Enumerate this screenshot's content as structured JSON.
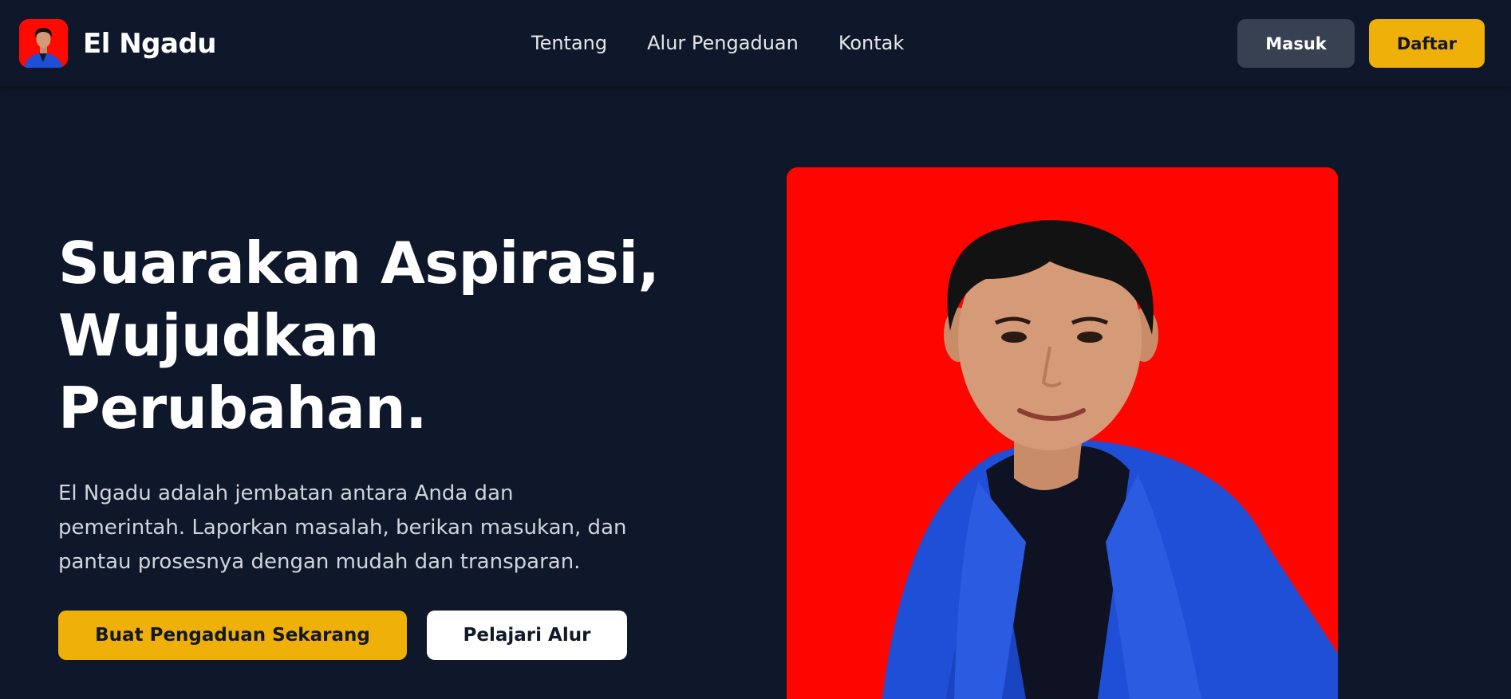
{
  "brand": {
    "name": "El Ngadu",
    "logo_icon": "profile-photo-icon"
  },
  "nav": {
    "links": [
      "Tentang",
      "Alur Pengaduan",
      "Kontak"
    ]
  },
  "auth": {
    "login_label": "Masuk",
    "register_label": "Daftar"
  },
  "hero": {
    "title_lines": [
      "Suarakan Aspirasi,",
      "Wujudkan",
      "Perubahan."
    ],
    "description_lines": [
      "El Ngadu adalah jembatan antara Anda dan",
      "pemerintah. Laporkan masalah, berikan masukan, dan",
      "pantau prosesnya dengan mudah dan transparan."
    ],
    "primary_cta": "Buat Pengaduan Sekarang",
    "secondary_cta": "Pelajari Alur",
    "image_icon": "portrait-photo"
  },
  "colors": {
    "background": "#0f172a",
    "accent": "#f0b00a",
    "secondary_button": "#374151",
    "photo_background": "#ff0500",
    "jacket": "#1f4fd6"
  }
}
